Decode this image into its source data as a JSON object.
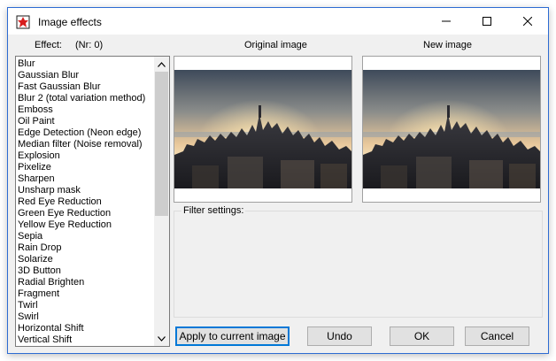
{
  "window": {
    "title": "Image effects",
    "accent": "#0078d7"
  },
  "header": {
    "effect_label": "Effect:",
    "effect_number": "(Nr: 0)",
    "original_label": "Original image",
    "new_label": "New image"
  },
  "effects": [
    "Blur",
    "Gaussian Blur",
    "Fast Gaussian Blur",
    "Blur 2 (total variation method)",
    "Emboss",
    "Oil Paint",
    "Edge Detection (Neon edge)",
    "Median filter (Noise removal)",
    "Explosion",
    "Pixelize",
    "Sharpen",
    "Unsharp mask",
    "Red Eye Reduction",
    "Green Eye Reduction",
    "Yellow Eye Reduction",
    "Sepia",
    "Rain Drop",
    "Solarize",
    "3D Button",
    "Radial Brighten",
    "Fragment",
    "Twirl",
    "Swirl",
    "Horizontal Shift",
    "Vertical Shift"
  ],
  "filter_settings": {
    "label": "Filter settings:"
  },
  "buttons": {
    "apply": "Apply to current image",
    "undo": "Undo",
    "ok": "OK",
    "cancel": "Cancel"
  }
}
